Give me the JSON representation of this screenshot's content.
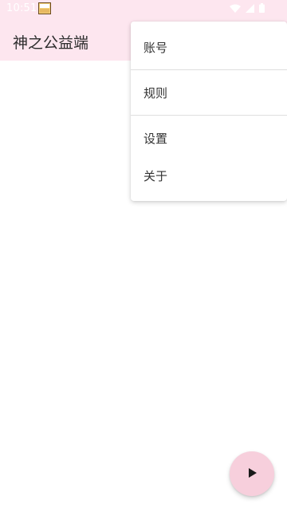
{
  "status_bar": {
    "time": "10:51",
    "icons": [
      "app-notification-icon",
      "wifi-icon",
      "signal-icon",
      "battery-icon"
    ]
  },
  "app_bar": {
    "title": "神之公益端",
    "background": "#fde6ef"
  },
  "menu": {
    "items": [
      {
        "label": "账号"
      },
      {
        "label": "规则"
      },
      {
        "label": "设置"
      },
      {
        "label": "关于"
      }
    ]
  },
  "fab": {
    "icon": "play-icon",
    "color": "#f7cfdc"
  }
}
